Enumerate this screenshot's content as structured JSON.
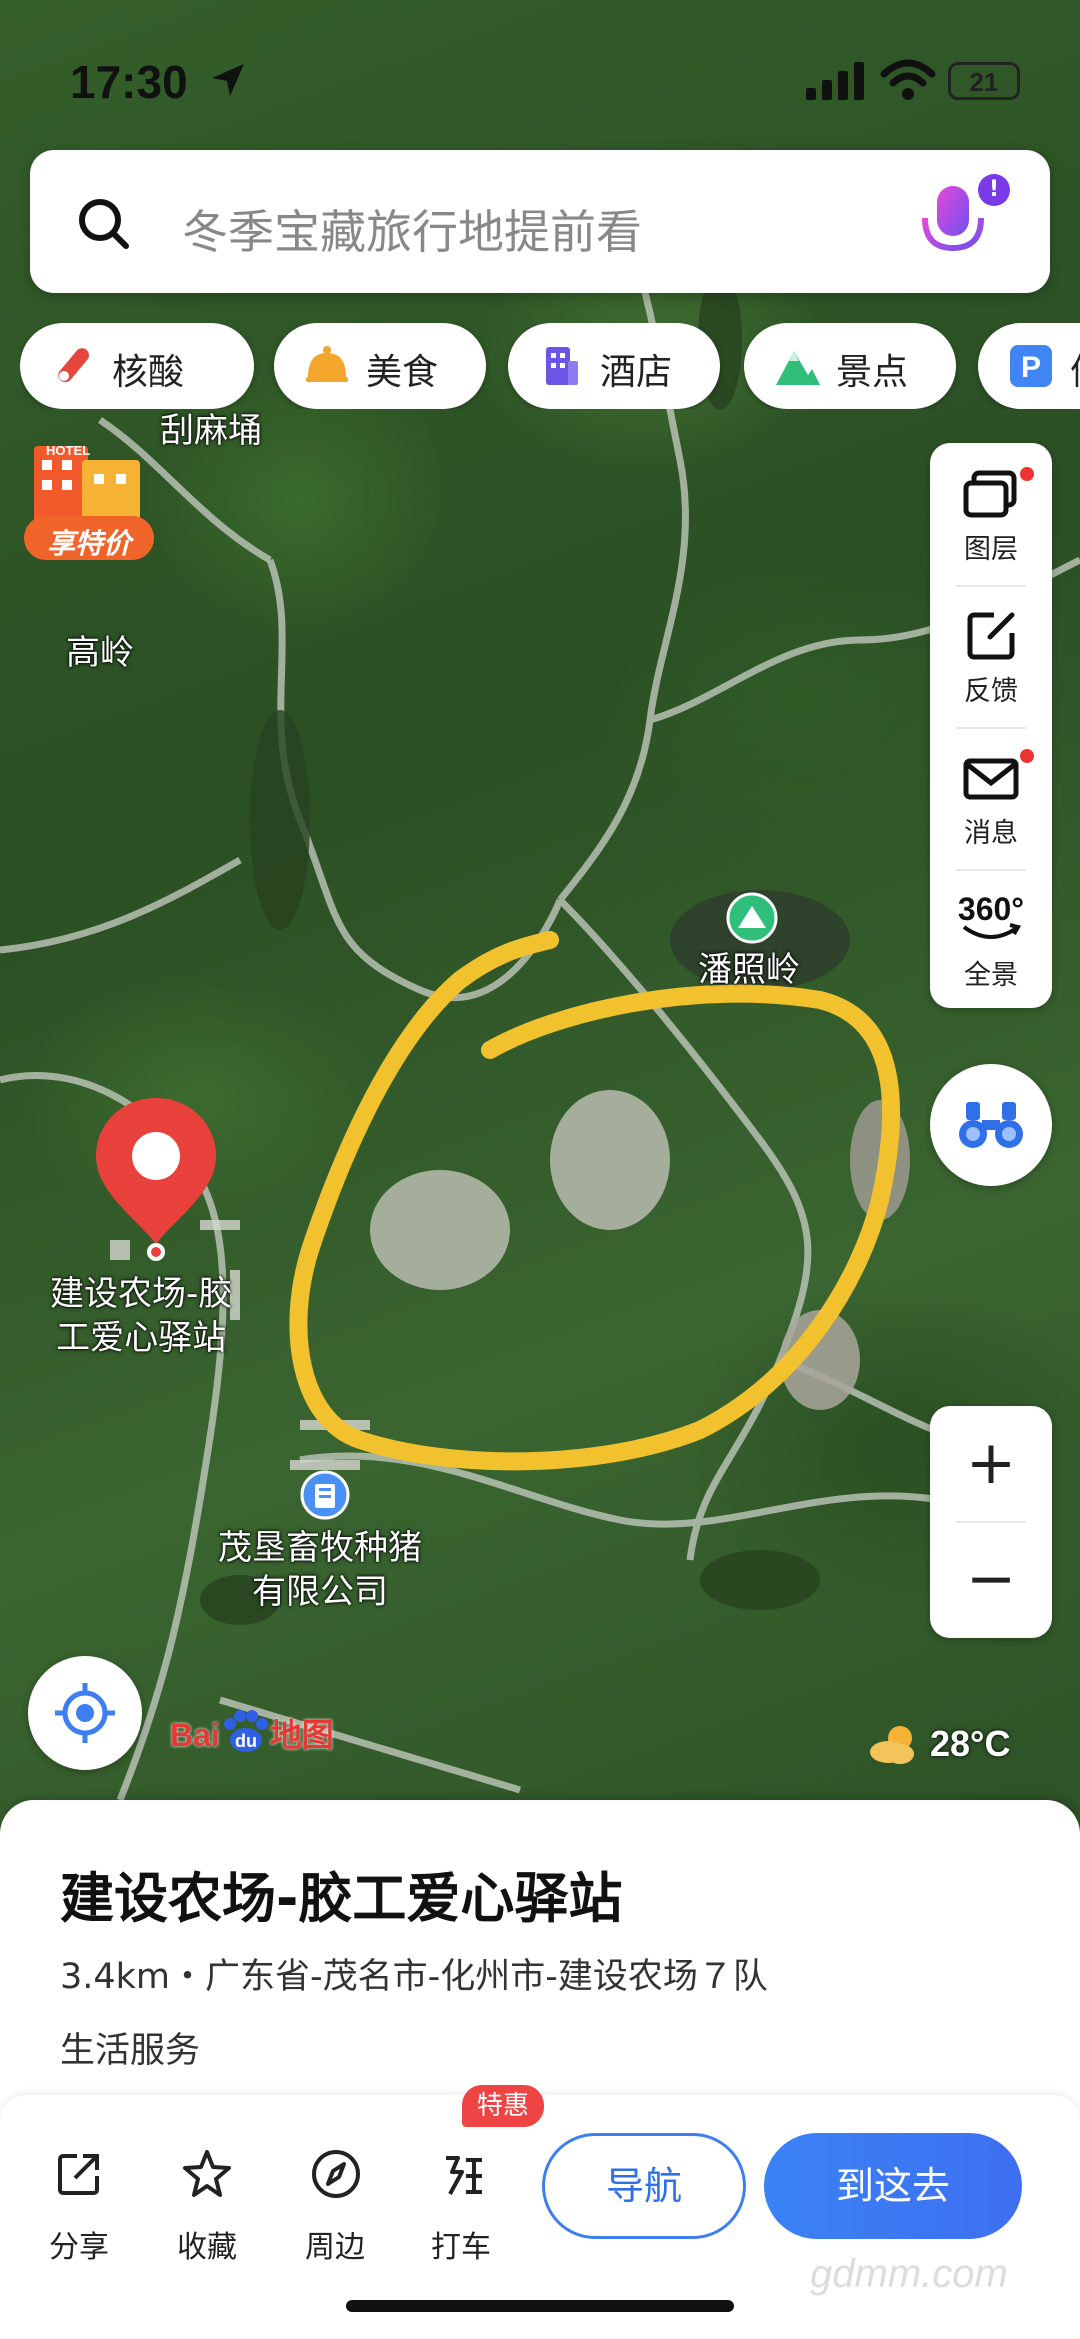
{
  "status_bar": {
    "time": "17:30",
    "battery": "21"
  },
  "search": {
    "placeholder": "冬季宝藏旅行地提前看"
  },
  "categories": [
    {
      "label": "核酸",
      "icon": "test-tube-icon"
    },
    {
      "label": "美食",
      "icon": "food-dome-icon"
    },
    {
      "label": "酒店",
      "icon": "hotel-building-icon"
    },
    {
      "label": "景点",
      "icon": "mountain-icon"
    },
    {
      "label": "停",
      "icon": "parking-icon"
    }
  ],
  "hotel_promo": {
    "tag": "HOTEL",
    "label": "享特价"
  },
  "map_labels": {
    "guamayong": "刮麻埇",
    "gaoling": "高岭",
    "panzhaoling": "潘照岭",
    "pin_name_line1": "建设农场-胶",
    "pin_name_line2": "工爱心驿站",
    "company_line1": "茂垦畜牧种猪",
    "company_line2": "有限公司"
  },
  "tools": [
    {
      "label": "图层",
      "icon": "layers-icon",
      "badge": true
    },
    {
      "label": "反馈",
      "icon": "feedback-icon",
      "badge": false
    },
    {
      "label": "消息",
      "icon": "message-icon",
      "badge": true
    },
    {
      "label": "全景",
      "icon": "panorama-360-icon",
      "badge": false
    }
  ],
  "panorama_text": "360°",
  "zoom": {
    "in": "+",
    "out": "−"
  },
  "logo": {
    "text1": "Bai",
    "text2": "地图"
  },
  "weather": {
    "temp": "28°C"
  },
  "poi": {
    "title": "建设农场-胶工爱心驿站",
    "address": "3.4km・广东省-茂名市-化州市-建设农场７队",
    "category": "生活服务"
  },
  "actions": [
    {
      "label": "分享",
      "icon": "share-icon"
    },
    {
      "label": "收藏",
      "icon": "star-icon"
    },
    {
      "label": "周边",
      "icon": "compass-icon"
    },
    {
      "label": "打车",
      "icon": "taxi-icon"
    }
  ],
  "promo_badge": "特惠",
  "navigate_button": "导航",
  "go_button": "到这去",
  "watermark": "gdmm.com",
  "colors": {
    "accent": "#3d7ef0",
    "circle": "#f2c12e",
    "pin": "#e8413c"
  }
}
